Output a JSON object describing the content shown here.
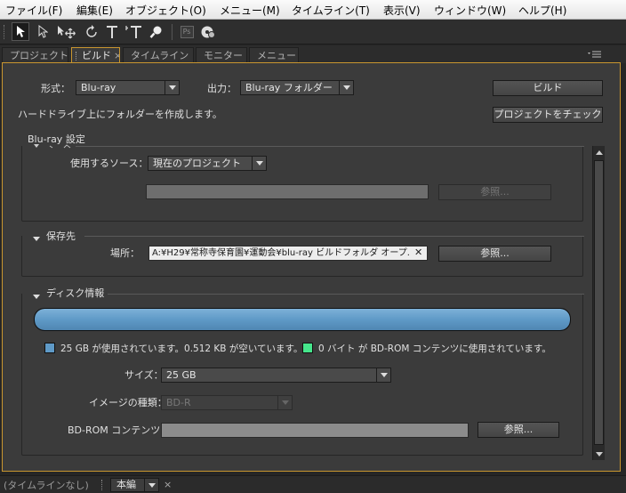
{
  "menubar": [
    "ファイル(F)",
    "編集(E)",
    "オブジェクト(O)",
    "メニュー(M)",
    "タイムライン(T)",
    "表示(V)",
    "ウィンドウ(W)",
    "ヘルプ(H)"
  ],
  "toolbar": {
    "tools": [
      "selection-tool",
      "direct-select-tool",
      "move-tool",
      "rotate-tool",
      "horizontal-text-tool",
      "vertical-text-tool",
      "zoom-tool"
    ],
    "extra_icons": [
      "photoshop-icon",
      "preview-disc-icon"
    ],
    "ps_label": "Ps"
  },
  "tabs": [
    "プロジェクト",
    "ビルド",
    "タイムライン",
    "モニター",
    "メニュー"
  ],
  "active_tab": "ビルド",
  "build": {
    "format_label": "形式：",
    "format_value": "Blu-ray",
    "output_label": "出力：",
    "output_value": "Blu-ray フォルダー",
    "build_button": "ビルド",
    "info_text": "ハードドライブ上にフォルダーを作成します。",
    "check_button": "プロジェクトをチェック",
    "settings_header": "Blu-ray 設定",
    "source": {
      "label": "使用するソース：",
      "value": "現在のプロジェクト",
      "path_value": "",
      "browse": "参照..."
    },
    "save": {
      "header": "保存先",
      "location_label": "場所：",
      "location_value": "A:¥H29¥常称寺保育園¥運動会¥blu-ray ビルドフォルダ オープ.",
      "browse": "参照..."
    },
    "disc": {
      "header": "ディスク情報",
      "usage_fraction": 1.0,
      "used_text": "25 GB が使用されています。0.512 KB が空いています。",
      "bdrom_text": "0 バイト が BD-ROM コンテンツに使用されています。",
      "used_color": "#5f9ac7",
      "bdrom_color": "#46e68c",
      "size_label": "サイズ：",
      "size_value": "25 GB",
      "image_type_label": "イメージの種類：",
      "image_type_value": "BD-R",
      "bdrom_label": "BD-ROM コンテンツ：",
      "bdrom_value": "",
      "browse": "参照..."
    }
  },
  "statusbar": {
    "no_timeline": "(タイムラインなし)",
    "sequence": "本編"
  },
  "colors": {
    "panel_border": "#c9962f",
    "progress_fill": "#5f9ac7"
  }
}
